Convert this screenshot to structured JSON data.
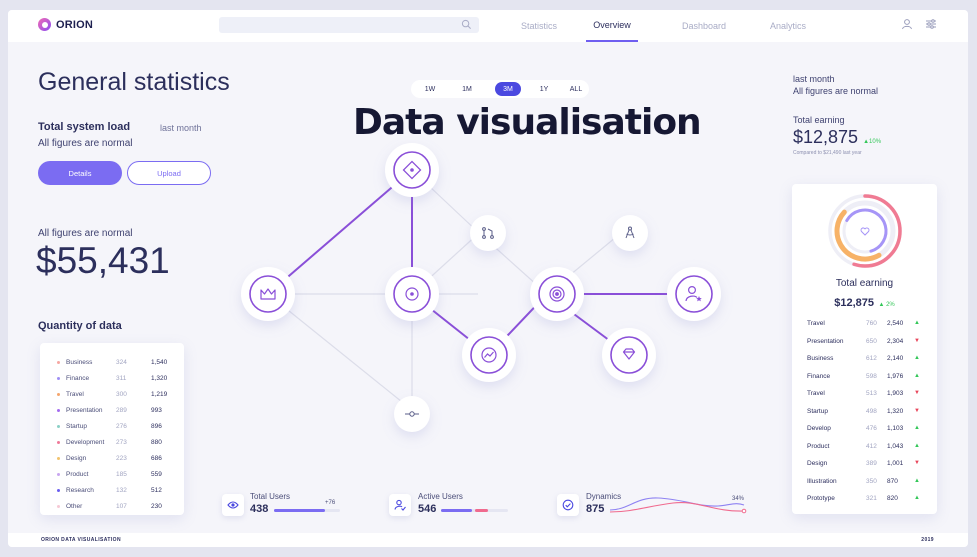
{
  "app": {
    "logo": "ORION",
    "accent": "#7b6cf2"
  },
  "nav": [
    {
      "label": "Statistics",
      "active": false
    },
    {
      "label": "Overview",
      "active": true
    },
    {
      "label": "Dashboard",
      "active": false
    },
    {
      "label": "Analytics",
      "active": false
    }
  ],
  "header_icons": [
    "user-icon",
    "settings-sliders-icon",
    "search-icon"
  ],
  "left": {
    "title": "General statistics",
    "system_load_title": "Total system load",
    "system_load_period": "last month",
    "system_load_status": "All figures are normal",
    "details_button": "Details",
    "upload_button": "Upload",
    "big_status": "All figures are normal",
    "big_value": "$55,431",
    "quantity_title": "Quantity of data",
    "quantity_rows": [
      {
        "name": "Business",
        "a": "324",
        "b": "1,540",
        "color": "#f6a7a2"
      },
      {
        "name": "Finance",
        "a": "311",
        "b": "1,320",
        "color": "#9f8ff5"
      },
      {
        "name": "Travel",
        "a": "300",
        "b": "1,219",
        "color": "#f5a56d"
      },
      {
        "name": "Presentation",
        "a": "289",
        "b": "993",
        "color": "#a46bf0"
      },
      {
        "name": "Startup",
        "a": "276",
        "b": "896",
        "color": "#8bd0c6"
      },
      {
        "name": "Development",
        "a": "273",
        "b": "880",
        "color": "#ef7a9a"
      },
      {
        "name": "Design",
        "a": "223",
        "b": "686",
        "color": "#f2c36e"
      },
      {
        "name": "Product",
        "a": "185",
        "b": "559",
        "color": "#c9a5f0"
      },
      {
        "name": "Research",
        "a": "132",
        "b": "512",
        "color": "#6a5ef0"
      },
      {
        "name": "Other",
        "a": "107",
        "b": "230",
        "color": "#f6c9d5"
      }
    ]
  },
  "center": {
    "ranges": [
      {
        "label": "1W",
        "active": false
      },
      {
        "label": "1M",
        "active": false
      },
      {
        "label": "3M",
        "active": true
      },
      {
        "label": "1Y",
        "active": false
      },
      {
        "label": "ALL",
        "active": false
      }
    ],
    "title": "Data visualisation",
    "nodes": [
      {
        "icon": "diamond-target-icon",
        "highlight": true
      },
      {
        "icon": "crown-icon",
        "highlight": true
      },
      {
        "icon": "target-dot-icon",
        "highlight": true
      },
      {
        "icon": "pull-request-icon",
        "highlight": false
      },
      {
        "icon": "bullseye-icon",
        "highlight": true
      },
      {
        "icon": "compass-icon",
        "highlight": false
      },
      {
        "icon": "user-star-icon",
        "highlight": true
      },
      {
        "icon": "trend-icon",
        "highlight": true
      },
      {
        "icon": "gem-icon",
        "highlight": true
      },
      {
        "icon": "commit-icon",
        "highlight": false
      }
    ]
  },
  "stats": [
    {
      "label": "Total Users",
      "value": "438",
      "delta": "+76",
      "icon": "eye-icon",
      "progress": 0.78
    },
    {
      "label": "Active Users",
      "value": "546",
      "icon": "user-check-icon",
      "progress": 0.46,
      "progress2": 0.2
    },
    {
      "label": "Dynamics",
      "value": "875",
      "percent": "34%",
      "icon": "check-circle-icon"
    }
  ],
  "right": {
    "period": "last month",
    "status": "All figures are normal",
    "earning_label": "Total earning",
    "earning_value": "$12,875",
    "earning_delta": "▲10%",
    "compare": "Compared to $21,490 last year",
    "card_label": "Total earning",
    "card_value": "$12,875",
    "card_delta": "▲ 2%",
    "donut": [
      {
        "fraction": 0.55,
        "color": "#f07b93"
      },
      {
        "fraction": 0.45,
        "color": "#f7b267"
      },
      {
        "fraction": 0.62,
        "color": "#a695f7"
      }
    ],
    "rows": [
      {
        "name": "Travel",
        "a": "760",
        "b": "2,540",
        "trend": "up"
      },
      {
        "name": "Presentation",
        "a": "650",
        "b": "2,304",
        "trend": "down"
      },
      {
        "name": "Business",
        "a": "612",
        "b": "2,140",
        "trend": "up"
      },
      {
        "name": "Finance",
        "a": "598",
        "b": "1,976",
        "trend": "up"
      },
      {
        "name": "Travel",
        "a": "513",
        "b": "1,903",
        "trend": "down"
      },
      {
        "name": "Startup",
        "a": "498",
        "b": "1,320",
        "trend": "down"
      },
      {
        "name": "Develop",
        "a": "476",
        "b": "1,103",
        "trend": "up"
      },
      {
        "name": "Product",
        "a": "412",
        "b": "1,043",
        "trend": "up"
      },
      {
        "name": "Design",
        "a": "389",
        "b": "1,001",
        "trend": "down"
      },
      {
        "name": "Illustration",
        "a": "350",
        "b": "870",
        "trend": "up"
      },
      {
        "name": "Prototype",
        "a": "321",
        "b": "820",
        "trend": "up"
      }
    ],
    "up_color": "#34c759",
    "down_color": "#e8455a"
  },
  "footer": {
    "left": "ORION DATA VISUALISATION",
    "right": "2019"
  }
}
